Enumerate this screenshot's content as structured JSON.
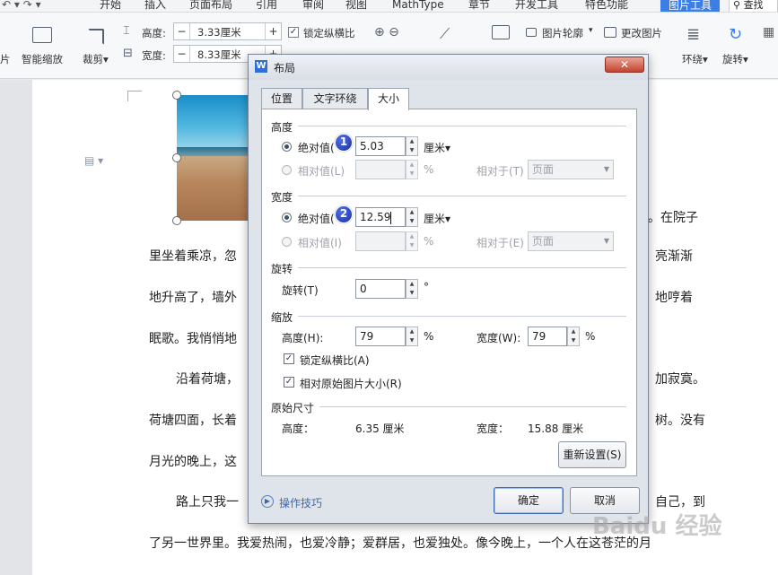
{
  "ribbon": {
    "tabs": [
      "开始",
      "插入",
      "页面布局",
      "引用",
      "审阅",
      "视图",
      "MathType",
      "章节",
      "开发工具",
      "特色功能"
    ],
    "active_tab": "图片工具",
    "search": "查找",
    "crop_prefix": "片",
    "smart_zoom": "智能缩放",
    "crop": "裁剪",
    "height_label": "高度:",
    "height_value": "3.33厘米",
    "width_label": "宽度:",
    "width_value": "8.33厘米",
    "lock_ratio": "锁定纵横比",
    "outline": "图片轮廓",
    "change_picture": "更改图片",
    "wrap": "环绕",
    "rotate": "旋转",
    "minus": "−",
    "plus": "+"
  },
  "document": {
    "lines": [
      {
        "left": "里坐着乘凉，忽",
        "right": "亮渐渐"
      },
      {
        "left": "地升高了，墙外",
        "right": "地哼着"
      },
      {
        "left": "眠歌。我悄悄地",
        "right": ""
      },
      {
        "left": "沿着荷塘，",
        "right": "加寂寞。"
      },
      {
        "left": "荷塘四面，长着",
        "right": "树。没有"
      },
      {
        "left": "月光的晚上，这",
        "right": ""
      },
      {
        "left": "路上只我一",
        "right": "自己，到"
      }
    ],
    "right_top": "。在院子",
    "last_line": "了另一世界里。我爱热闹，也爱冷静；爱群居，也爱独处。像今晚上，一个人在这苍茫的月"
  },
  "dialog": {
    "title": "布局",
    "close": "✕",
    "tabs": [
      "位置",
      "文字环绕",
      "大小"
    ],
    "height_section": "高度",
    "abs_label": "绝对值(",
    "rel_label": "相对值(L)",
    "height_abs": "5.03",
    "unit": "厘米",
    "percent": "%",
    "relative_to": "相对于(T)",
    "relative_to_w": "相对于(E)",
    "page": "页面",
    "width_section": "宽度",
    "width_abs": "12.59",
    "rel_label_w": "相对值(I)",
    "rotate_section": "旋转",
    "rotate_label": "旋转(T)",
    "rotate_value": "0",
    "degree": "°",
    "scale_section": "缩放",
    "scale_height_label": "高度(H):",
    "scale_height": "79",
    "scale_width_label": "宽度(W):",
    "scale_width": "79",
    "lock_ratio": "锁定纵横比(A)",
    "relative_original": "相对原始图片大小(R)",
    "original_section": "原始尺寸",
    "orig_height_label": "高度：",
    "orig_height": "6.35 厘米",
    "orig_width_label": "宽度：",
    "orig_width": "15.88 厘米",
    "reset": "重新设置(S)",
    "tips": "操作技巧",
    "ok": "确定",
    "cancel": "取消",
    "badge1": "1",
    "badge2": "2"
  },
  "watermark": "Baidu 经验"
}
